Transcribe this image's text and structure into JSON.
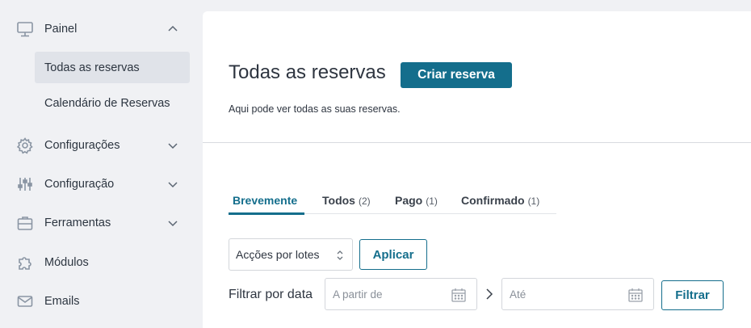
{
  "sidebar": {
    "items": [
      {
        "label": "Painel",
        "icon": "monitor-icon",
        "expanded": true
      },
      {
        "label": "Todas as reservas",
        "active": true
      },
      {
        "label": "Calendário de Reservas"
      },
      {
        "label": "Configurações",
        "icon": "gear-icon"
      },
      {
        "label": "Configuração",
        "icon": "sliders-icon"
      },
      {
        "label": "Ferramentas",
        "icon": "briefcase-icon"
      },
      {
        "label": "Módulos",
        "icon": "puzzle-icon"
      },
      {
        "label": "Emails",
        "icon": "envelope-icon"
      }
    ]
  },
  "main": {
    "title": "Todas as reservas",
    "create_button": "Criar reserva",
    "description": "Aqui pode ver todas as suas reservas.",
    "tabs": [
      {
        "label": "Brevemente",
        "count": "",
        "active": true
      },
      {
        "label": "Todos",
        "count": "(2)"
      },
      {
        "label": "Pago",
        "count": "(1)"
      },
      {
        "label": "Confirmado",
        "count": "(1)"
      }
    ],
    "bulk_actions": {
      "selected": "Acções por lotes"
    },
    "apply_button": "Aplicar",
    "filter": {
      "label": "Filtrar por data",
      "from_placeholder": "A partir de",
      "to_placeholder": "Até",
      "button": "Filtrar"
    }
  },
  "colors": {
    "accent": "#146e8c",
    "sidebar_bg": "#f0f1f4",
    "active_item_bg": "#e0e3e9"
  }
}
